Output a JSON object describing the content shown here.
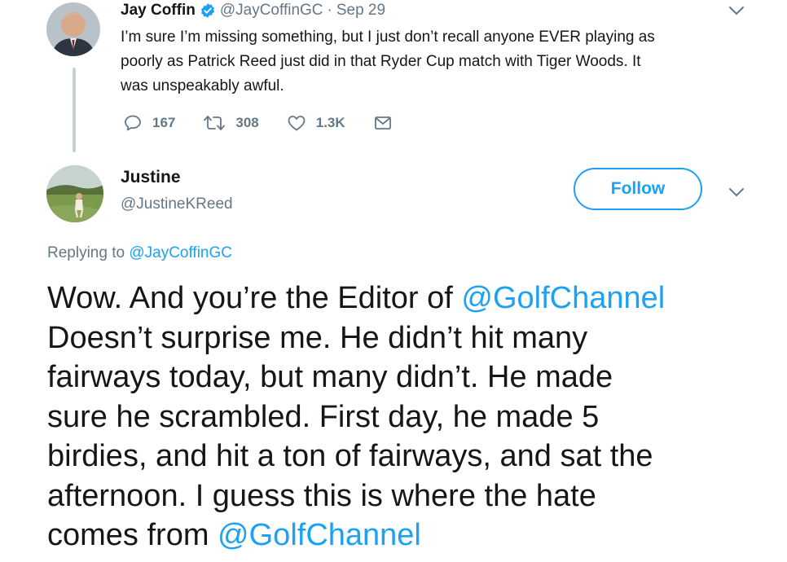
{
  "parent_tweet": {
    "author_name": "Jay Coffin",
    "author_handle": "@JayCoffinGC",
    "separator": "·",
    "date": "Sep 29",
    "text_lines": [
      "I’m sure I’m missing something, but I just don’t recall anyone EVER playing as",
      "poorly as Patrick Reed just did in that Ryder Cup match with Tiger Woods. It",
      "was unspeakably awful."
    ],
    "stats": {
      "replies": "167",
      "retweets": "308",
      "likes": "1.3K"
    },
    "verified": true
  },
  "reply_tweet": {
    "author_name": "Justine",
    "author_handle": "@JustineKReed",
    "follow_label": "Follow",
    "replying_prefix": "Replying to",
    "replying_to": "@JayCoffinGC",
    "text_lines": [
      {
        "text": "Wow. And you’re the Editor of ",
        "mention": "@GolfChannel"
      },
      {
        "text": "Doesn’t surprise me. He didn’t hit many",
        "mention": ""
      },
      {
        "text": "fairways today, but many didn’t. He made",
        "mention": ""
      },
      {
        "text": "sure he scrambled. First day, he made 5",
        "mention": ""
      },
      {
        "text": "birdies, and hit a ton of fairways, and sat the",
        "mention": ""
      },
      {
        "text": "afternoon. I guess this is where the hate",
        "mention": ""
      },
      {
        "text": "comes from ",
        "mention": "@GolfChannel"
      }
    ]
  },
  "colors": {
    "accent": "#1da1f2",
    "muted": "#657786",
    "text": "#14171a",
    "thread_line": "#c4cfd6"
  },
  "icons": {
    "verified": "verified-badge-icon",
    "reply": "reply-icon",
    "retweet": "retweet-icon",
    "like": "heart-icon",
    "dm": "envelope-icon",
    "menu": "chevron-down-icon"
  }
}
